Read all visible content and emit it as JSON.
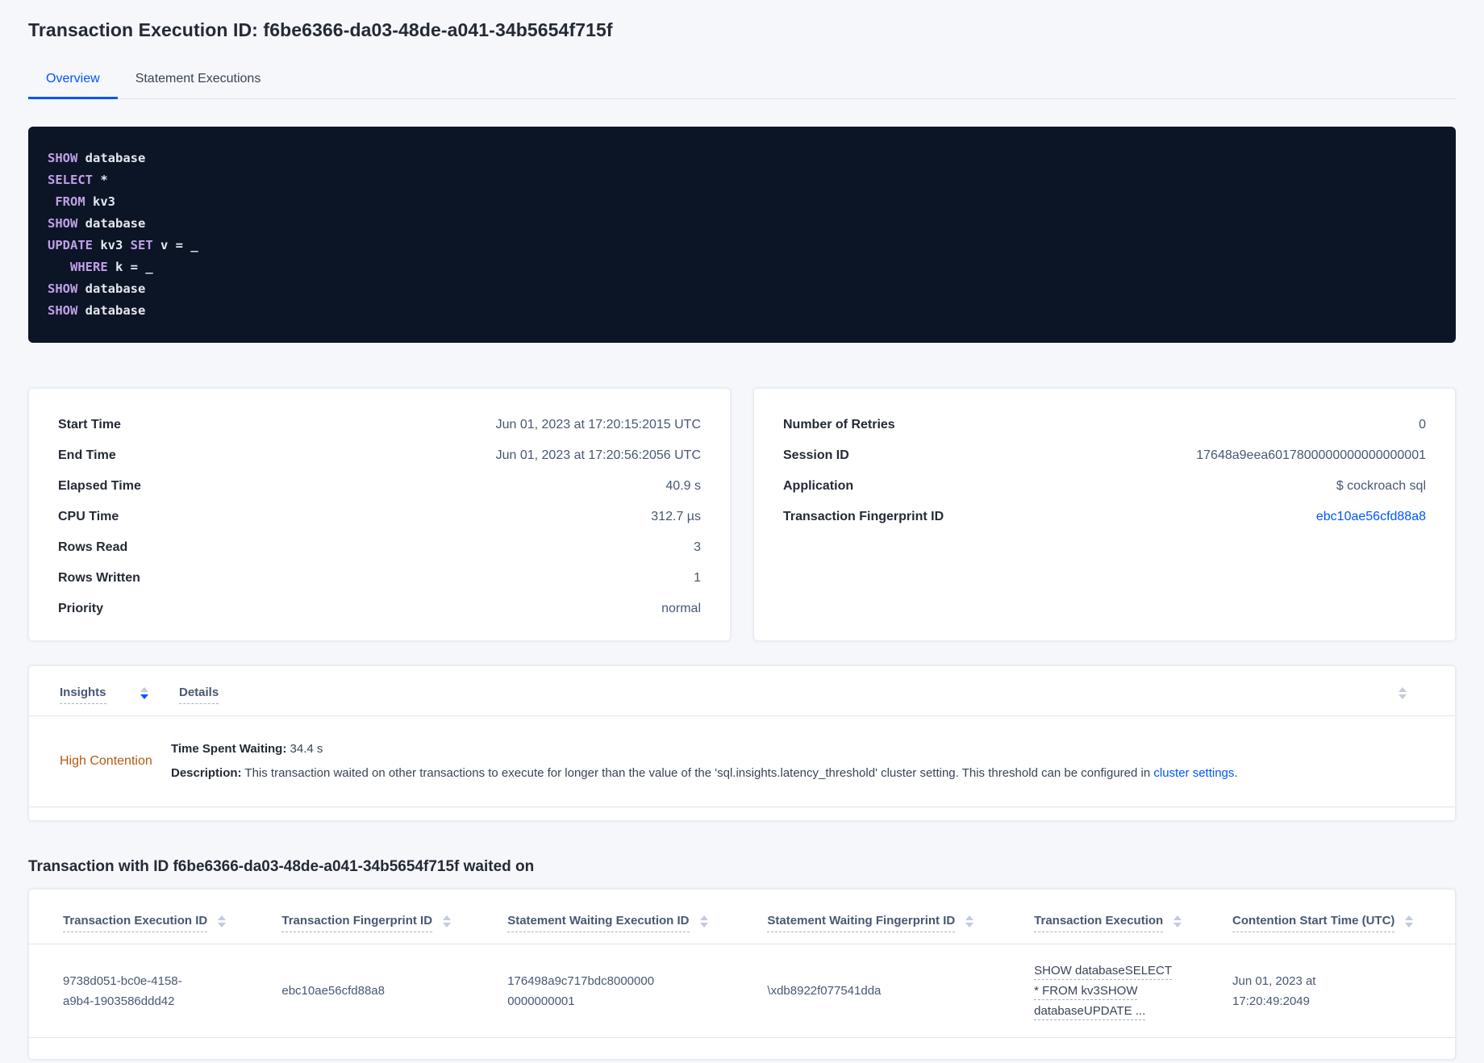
{
  "page": {
    "title": "Transaction Execution ID: f6be6366-da03-48de-a041-34b5654f715f",
    "waited_heading": "Transaction with ID f6be6366-da03-48de-a041-34b5654f715f waited on"
  },
  "tabs": [
    {
      "label": "Overview",
      "active": true
    },
    {
      "label": "Statement Executions",
      "active": false
    }
  ],
  "sql": {
    "lines": [
      {
        "kw": "SHOW",
        "pl": " database"
      },
      {
        "kw": "SELECT",
        "pl": " *"
      },
      {
        "kw": " FROM",
        "pl": " kv3"
      },
      {
        "kw": "SHOW",
        "pl": " database"
      },
      {
        "kw": "UPDATE",
        "pl": " kv3 ",
        "kw2": "SET",
        "pl2": " v = _"
      },
      {
        "kw": "   WHERE",
        "pl": " k = _"
      },
      {
        "kw": "SHOW",
        "pl": " database"
      },
      {
        "kw": "SHOW",
        "pl": " database"
      }
    ]
  },
  "overview_left": {
    "rows": [
      {
        "label": "Start Time",
        "value": "Jun 01, 2023 at 17:20:15:2015 UTC"
      },
      {
        "label": "End Time",
        "value": "Jun 01, 2023 at 17:20:56:2056 UTC"
      },
      {
        "label": "Elapsed Time",
        "value": "40.9 s"
      },
      {
        "label": "CPU Time",
        "value": "312.7 µs"
      },
      {
        "label": "Rows Read",
        "value": "3"
      },
      {
        "label": "Rows Written",
        "value": "1"
      },
      {
        "label": "Priority",
        "value": "normal"
      }
    ]
  },
  "overview_right": {
    "rows": [
      {
        "label": "Number of Retries",
        "value": "0"
      },
      {
        "label": "Session ID",
        "value": "17648a9eea6017800000000000000001"
      },
      {
        "label": "Application",
        "value": "$ cockroach sql"
      }
    ],
    "fingerprint": {
      "label": "Transaction Fingerprint ID",
      "value": "ebc10ae56cfd88a8"
    }
  },
  "insights": {
    "columns": {
      "insights": "Insights",
      "details": "Details"
    },
    "row": {
      "insight": "High Contention",
      "waiting_label": "Time Spent Waiting:",
      "waiting_value": " 34.4 s",
      "desc_label": "Description:",
      "desc_text": " This transaction waited on other transactions to execute for longer than the value of the 'sql.insights.latency_threshold' cluster setting. This threshold can be configured in ",
      "desc_link": "cluster settings",
      "desc_suffix": "."
    }
  },
  "waited_table": {
    "columns": [
      "Transaction Execution ID",
      "Transaction Fingerprint ID",
      "Statement Waiting Execution ID",
      "Statement Waiting Fingerprint ID",
      "Transaction Execution",
      "Contention Start Time (UTC)"
    ],
    "row": {
      "txn_execution_id": "9738d051-bc0e-4158-a9b4-1903586ddd42",
      "txn_fingerprint_id": "ebc10ae56cfd88a8",
      "stmt_waiting_execution_id": "176498a9c717bdc80000000000000001",
      "stmt_waiting_fingerprint_id": "\\xdb8922f077541dda",
      "txn_execution": "SHOW databaseSELECT * FROM kv3SHOW databaseUPDATE ...",
      "contention_start_time": "Jun 01, 2023 at 17:20:49:2049"
    }
  },
  "icons": {
    "sort": "sort-arrows"
  },
  "colors": {
    "accent_blue": "#0055ff",
    "warning_orange": "#b45a10",
    "code_keyword": "#c0a0e8",
    "code_background": "#0c1525",
    "page_background": "#f5f7fa"
  }
}
